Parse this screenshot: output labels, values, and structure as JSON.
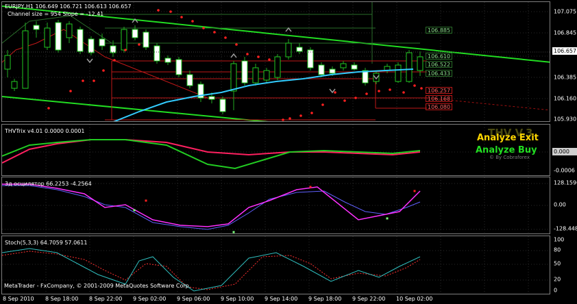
{
  "main": {
    "header_line1": "EURJPY,H1  106.649 106.721 106.613 106.657",
    "header_line2": "Channel size = 954 Slope = -12.41",
    "y_ticks": [
      "107.075",
      "106.845",
      "106.657",
      "106.385",
      "106.160",
      "105.930"
    ],
    "current_price": "106.657",
    "upper_levels": [
      "106.885",
      "106.610",
      "106.522",
      "106.433"
    ],
    "lower_levels": [
      "106.257",
      "106.168",
      "106.080"
    ],
    "colors": {
      "channel": "#22dd22",
      "ma": "#33ccff",
      "up_level": "#2a6e2a",
      "down_level": "#c01818",
      "dots": "#ff2020"
    }
  },
  "thv": {
    "title": "THVTrix v4.01 0.0000 0.0001",
    "y_ticks": [
      "0.000",
      "-0.0006"
    ],
    "brand_logo": "THV V.3",
    "analyze_exit": "Analyze Exit",
    "analyze_buy": "Analyze Buy",
    "by_line": "© By Cobraforex"
  },
  "osc": {
    "title": "3д осцилятор 66.2253 -4.2564",
    "y_ticks": [
      "128.1596",
      "0.00",
      "-128.4484"
    ]
  },
  "stoch": {
    "title": "Stoch(5,3,3) 64.7059 57.0611",
    "y_ticks": [
      "100",
      "80",
      "50",
      "20",
      "0"
    ],
    "copyright": "MetaTrader - FxCompany, © 2001-2009 MetaQuotes Software Corp."
  },
  "x_labels": [
    "8 Sep 2010",
    "8 Sep 18:00",
    "8 Sep 22:00",
    "9 Sep 02:00",
    "9 Sep 06:00",
    "9 Sep 10:00",
    "9 Sep 14:00",
    "9 Sep 18:00",
    "9 Sep 22:00",
    "10 Sep 02:00"
  ]
}
